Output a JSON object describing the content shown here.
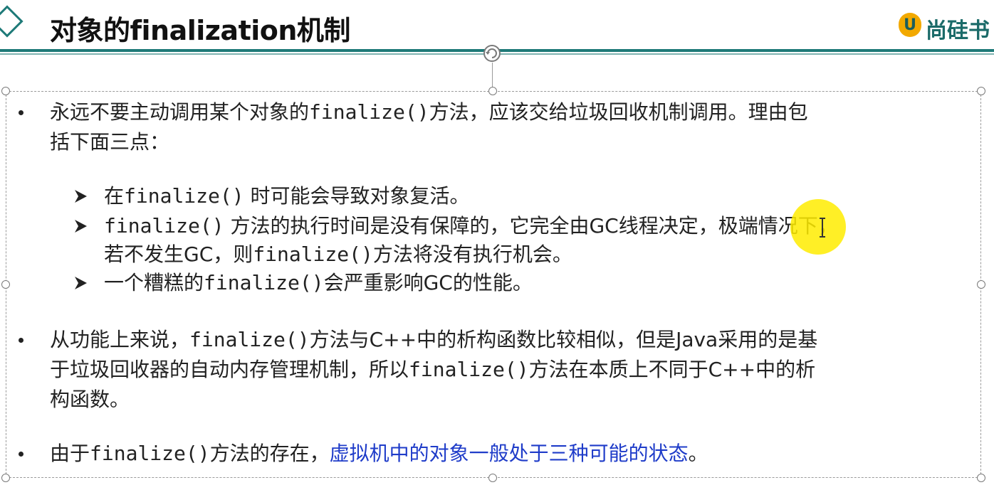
{
  "header": {
    "title": "对象的finalization机制",
    "logo_text": "尚硅书"
  },
  "bullets": [
    {
      "lines": [
        [
          {
            "t": "永远不要主动调用某个对象的",
            "s": "n"
          },
          {
            "t": "finalize()",
            "s": "m"
          },
          {
            "t": "方法，应该交给垃圾回收机制调用。理由包",
            "s": "n"
          }
        ],
        [
          {
            "t": "括下面三点：",
            "s": "n"
          }
        ]
      ]
    },
    {
      "lines": [
        [
          {
            "t": "从功能上来说，",
            "s": "n"
          },
          {
            "t": "finalize()",
            "s": "m"
          },
          {
            "t": "方法与C++中的析构函数比较相似，但是Java采用的是基",
            "s": "n"
          }
        ],
        [
          {
            "t": "于垃圾回收器的自动内存管理机制，所以",
            "s": "n"
          },
          {
            "t": "finalize()",
            "s": "m"
          },
          {
            "t": "方法在本质上不同于C++中的析",
            "s": "n"
          }
        ],
        [
          {
            "t": "构函数。",
            "s": "n"
          }
        ]
      ]
    },
    {
      "lines": [
        [
          {
            "t": "由于",
            "s": "n"
          },
          {
            "t": "finalize()",
            "s": "m"
          },
          {
            "t": "方法的存在，",
            "s": "n"
          },
          {
            "t": "虚拟机中的对象一般处于三种可能的状态",
            "s": "b"
          },
          {
            "t": "。",
            "s": "n"
          }
        ]
      ]
    }
  ],
  "subpoints": [
    {
      "lines": [
        [
          {
            "t": "在",
            "s": "n"
          },
          {
            "t": "finalize()",
            "s": "m"
          },
          {
            "t": " 时可能会导致对象复活。",
            "s": "n"
          }
        ]
      ]
    },
    {
      "lines": [
        [
          {
            "t": "finalize()",
            "s": "m"
          },
          {
            "t": " 方法的执行时间是没有保障的，它完全由GC线程决定，极端情况下，",
            "s": "n"
          }
        ],
        [
          {
            "t": "若不发生GC，则",
            "s": "n"
          },
          {
            "t": "finalize()",
            "s": "m"
          },
          {
            "t": "方法将没有执行机会。",
            "s": "n"
          }
        ]
      ]
    },
    {
      "lines": [
        [
          {
            "t": "一个糟糕的",
            "s": "n"
          },
          {
            "t": "finalize()",
            "s": "m"
          },
          {
            "t": "会严重影响GC的性能。",
            "s": "n"
          }
        ]
      ]
    }
  ],
  "colors": {
    "accent": "#1e7a78",
    "link_text": "#1f3cc9",
    "highlight": "#ffec00"
  }
}
